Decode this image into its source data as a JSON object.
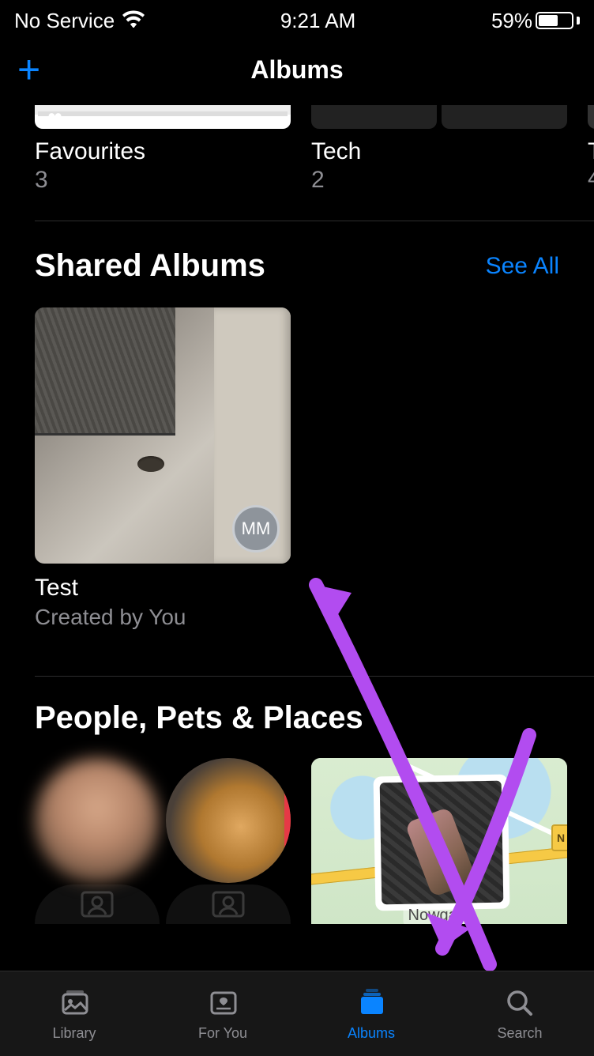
{
  "status": {
    "carrier": "No Service",
    "time": "9:21 AM",
    "battery_text": "59%"
  },
  "nav": {
    "title": "Albums",
    "add_label": "+"
  },
  "top_albums": [
    {
      "title": "Favourites",
      "count": "3"
    },
    {
      "title": "Tech",
      "count": "2"
    },
    {
      "title_peek": "T",
      "count_peek": "4"
    }
  ],
  "shared": {
    "section_title": "Shared Albums",
    "see_all": "See All",
    "album_title": "Test",
    "album_subtitle": "Created by You",
    "badge_initials": "MM"
  },
  "people_section": {
    "title": "People, Pets & Places",
    "map_label": "Nowgam",
    "map_badge": "N"
  },
  "tabs": {
    "library": "Library",
    "for_you": "For You",
    "albums": "Albums",
    "search": "Search"
  },
  "colors": {
    "accent": "#0a84ff",
    "annotation": "#b24cf0"
  }
}
